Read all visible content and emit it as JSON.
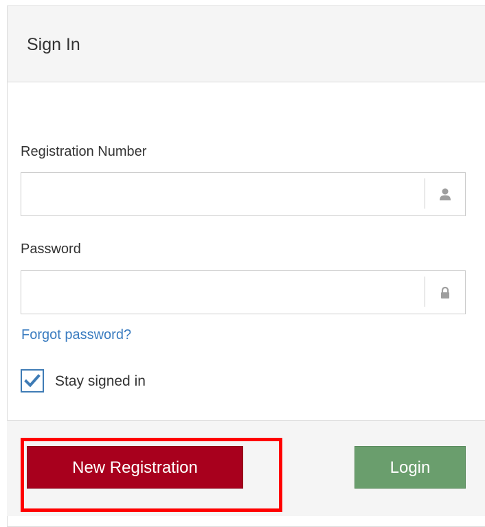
{
  "header": {
    "title": "Sign In"
  },
  "form": {
    "registration": {
      "label": "Registration Number",
      "value": "",
      "placeholder": "",
      "icon": "user-icon"
    },
    "password": {
      "label": "Password",
      "value": "",
      "placeholder": "",
      "icon": "lock-icon"
    },
    "forgot_link": "Forgot password?",
    "stay_signed_in": {
      "label": "Stay signed in",
      "checked": true
    }
  },
  "footer": {
    "new_registration_label": "New Registration",
    "login_label": "Login"
  },
  "colors": {
    "new_registration_bg": "#a8001d",
    "login_bg": "#6a9e6d",
    "link": "#3a7cc0",
    "checkbox_border": "#3e7bb5",
    "highlight": "#ff0000"
  }
}
